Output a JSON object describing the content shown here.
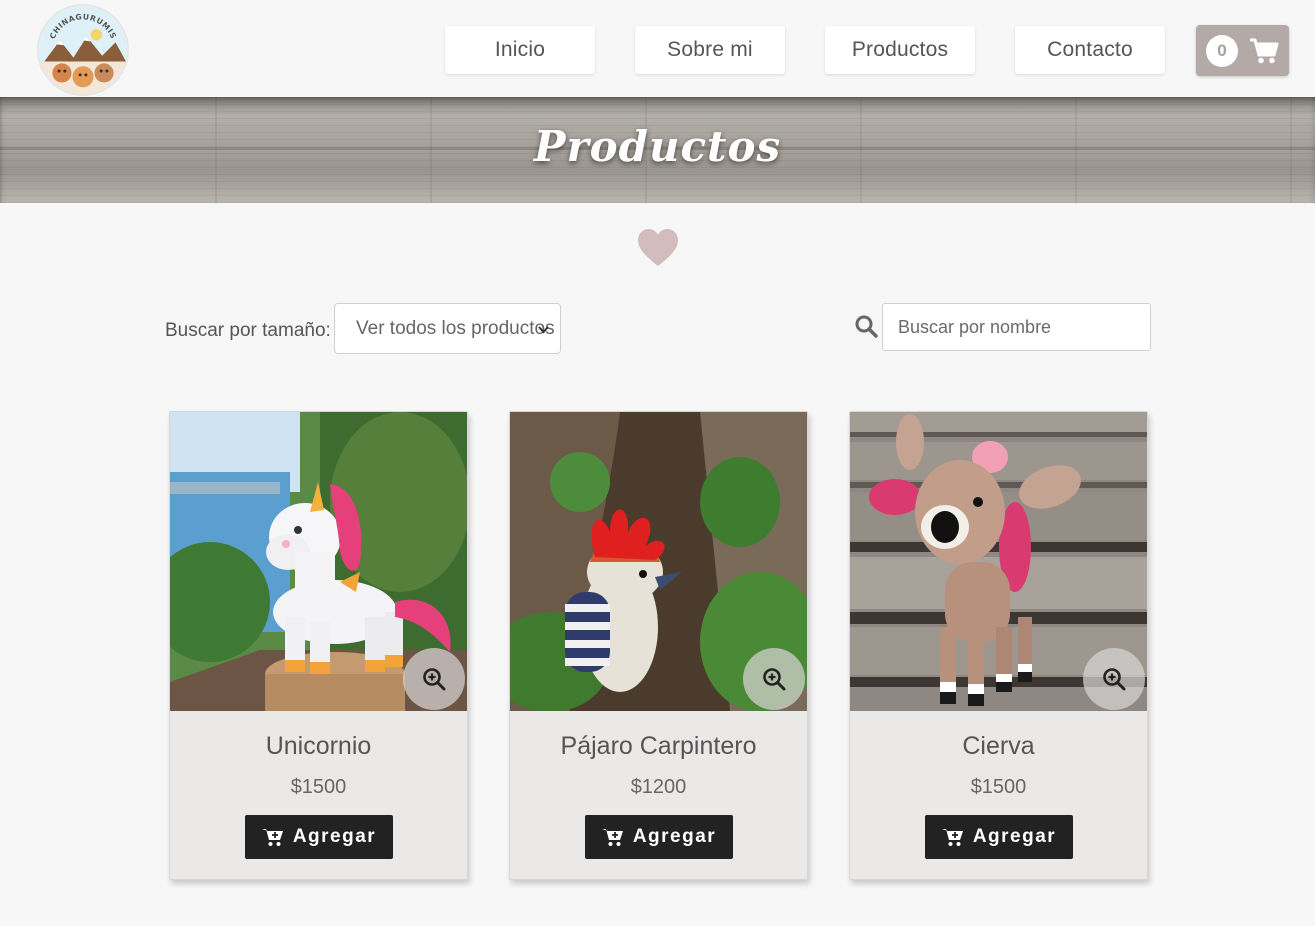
{
  "logo": {
    "text": "CHINAGURUMIS"
  },
  "nav": {
    "items": [
      {
        "label": "Inicio"
      },
      {
        "label": "Sobre mi"
      },
      {
        "label": "Productos"
      },
      {
        "label": "Contacto"
      }
    ]
  },
  "cart": {
    "count": "0",
    "icon": "shopping-cart-icon"
  },
  "banner": {
    "title": "Productos"
  },
  "decor": {
    "icon": "heart-icon",
    "color": "#d3bcbc"
  },
  "filters": {
    "size_label": "Buscar por tamaño:",
    "size_selected": "Ver todos los productos",
    "search_placeholder": "Buscar por nombre",
    "search_icon": "search-icon"
  },
  "products": [
    {
      "name": "Unicornio",
      "price": "$1500",
      "add_label": "Agregar"
    },
    {
      "name": "Pájaro Carpintero",
      "price": "$1200",
      "add_label": "Agregar"
    },
    {
      "name": "Cierva",
      "price": "$1500",
      "add_label": "Agregar"
    }
  ],
  "colors": {
    "accent_cart": "#b3a9a7",
    "button_dark": "#222222",
    "card_bg": "#ebe9e8",
    "page_bg": "#f7f7f7"
  }
}
